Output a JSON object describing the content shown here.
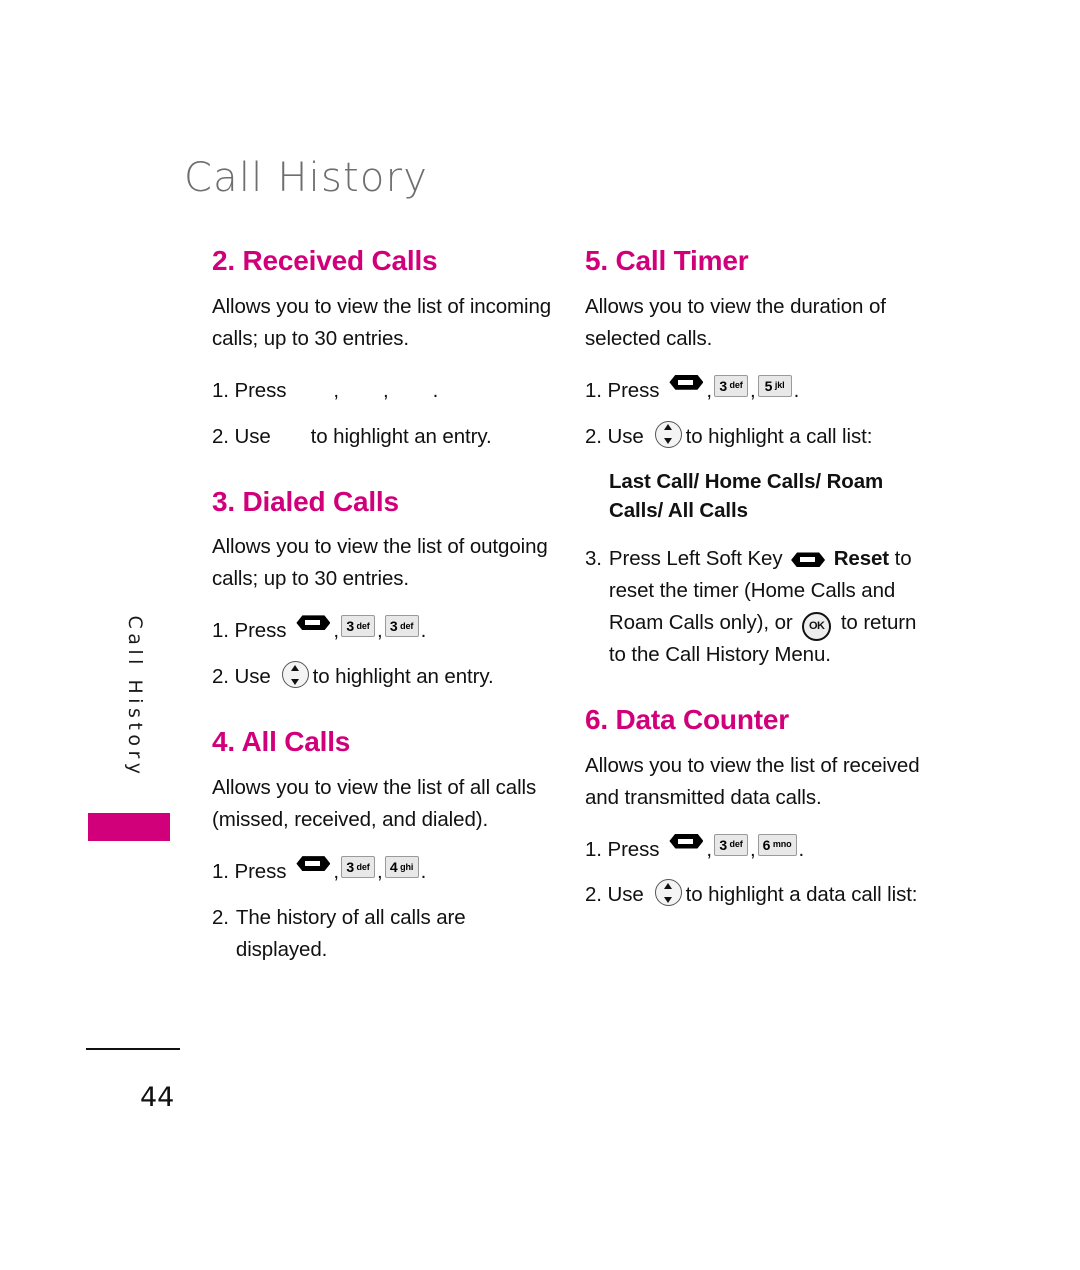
{
  "document": {
    "page_title": "Call History",
    "side_tab_label": "Call History",
    "page_number": "44",
    "accent_color": "#d1007a",
    "title_color": "#6e6e6e"
  },
  "icons": {
    "soft_key": "soft-key-icon",
    "nav_wheel": "navigation-wheel-icon",
    "ok_key": "ok-key-icon",
    "key_3": {
      "digit": "3",
      "letters": "def"
    },
    "key_4": {
      "digit": "4",
      "letters": "ghi"
    },
    "key_5": {
      "digit": "5",
      "letters": "jkl"
    },
    "key_6": {
      "digit": "6",
      "letters": "mno"
    }
  },
  "left_column": {
    "sections": [
      {
        "heading": "2. Received Calls",
        "body": "Allows you to view the list of incoming calls; up to 30 entries.",
        "step1_num": "1. Press",
        "step1_sep1": ",",
        "step1_sep2": ",",
        "step1_end": ".",
        "step2_num": "2. Use",
        "step2_text": "to highlight an entry."
      },
      {
        "heading": "3. Dialed Calls",
        "body": "Allows you to view the list of outgoing calls; up to 30 entries.",
        "step1_num": "1. Press",
        "step1_sep1": ",",
        "step1_sep2": ",",
        "step1_end": ".",
        "step2_num": "2.  Use",
        "step2_text": "to highlight an entry."
      },
      {
        "heading": "4. All Calls",
        "body": "Allows you to view the list of all calls (missed, received, and dialed).",
        "step1_num": "1. Press",
        "step1_sep1": ",",
        "step1_sep2": ",",
        "step1_end": ".",
        "step2_num": "2.",
        "step2_text": "The history of all calls are displayed."
      }
    ]
  },
  "right_column": {
    "sections": [
      {
        "heading": "5. Call Timer",
        "body": "Allows you to view the duration of selected calls.",
        "step1_num": "1. Press",
        "step1_sep1": ",",
        "step1_sep2": ",",
        "step1_end": ".",
        "step2_num": "2. Use",
        "step2_text": "to highlight a call list:",
        "list_bold": "Last Call/ Home Calls/ Roam Calls/ All Calls",
        "step3_num": "3.",
        "step3_text_a": "Press Left Soft Key",
        "step3_bold": "Reset",
        "step3_text_b": "to reset the timer (Home Calls and Roam Calls only), or",
        "step3_text_c": "to return to the Call History Menu."
      },
      {
        "heading": "6. Data Counter",
        "body": "Allows you to view the list of received and transmitted data calls.",
        "step1_num": "1. Press",
        "step1_sep1": ",",
        "step1_sep2": ",",
        "step1_end": ".",
        "step2_num": "2. Use",
        "step2_text": "to highlight a data call list:"
      }
    ]
  }
}
